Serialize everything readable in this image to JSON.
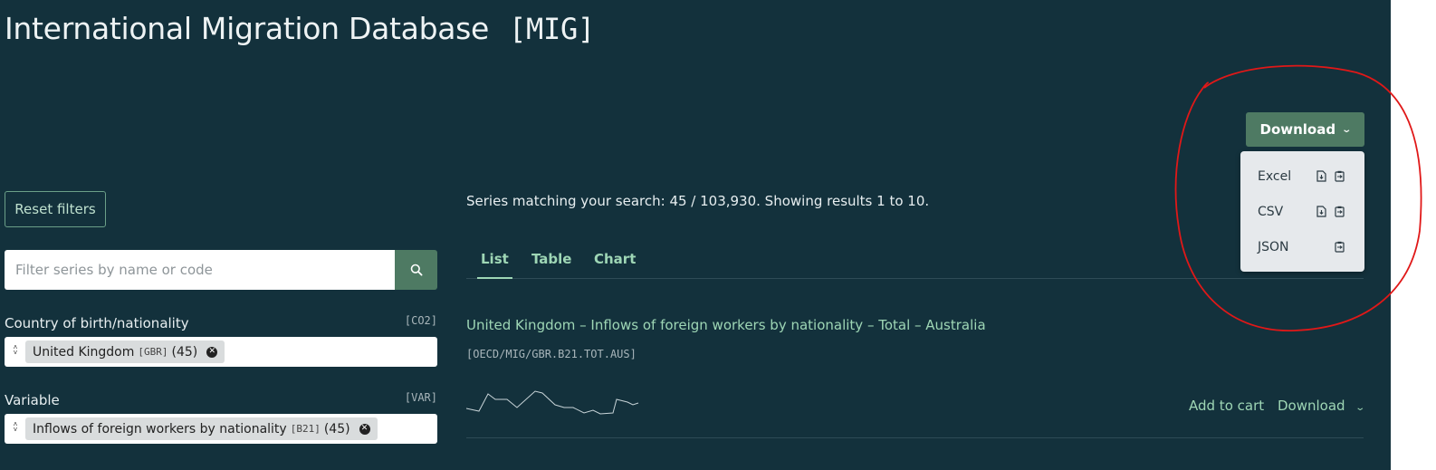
{
  "page": {
    "title": "International Migration Database",
    "code": "[MIG]"
  },
  "download_menu": {
    "button_label": "Download",
    "items": [
      {
        "label": "Excel",
        "icons": [
          "file-download-icon",
          "clipboard-copy-icon"
        ]
      },
      {
        "label": "CSV",
        "icons": [
          "file-download-icon",
          "clipboard-copy-icon"
        ]
      },
      {
        "label": "JSON",
        "icons": [
          "clipboard-copy-icon"
        ]
      }
    ]
  },
  "sidebar": {
    "reset_label": "Reset filters",
    "search": {
      "placeholder": "Filter series by name or code",
      "value": ""
    },
    "filters": [
      {
        "label": "Country of birth/nationality",
        "code": "[CO2]",
        "chip": {
          "text": "United Kingdom",
          "code": "[GBR]",
          "count": "(45)"
        }
      },
      {
        "label": "Variable",
        "code": "[VAR]",
        "chip": {
          "text": "Inflows of foreign workers by nationality",
          "code": "[B21]",
          "count": "(45)"
        }
      }
    ]
  },
  "main": {
    "summary": "Series matching your search: 45 / 103,930. Showing results 1 to 10.",
    "tabs": [
      {
        "label": "List",
        "active": true
      },
      {
        "label": "Table",
        "active": false
      },
      {
        "label": "Chart",
        "active": false
      }
    ],
    "results": [
      {
        "title": "United Kingdom – Inflows of foreign workers by nationality – Total – Australia",
        "code": "[OECD/MIG/GBR.B21.TOT.AUS]",
        "add_to_cart": "Add to cart",
        "download": "Download"
      }
    ]
  },
  "colors": {
    "background": "#13313c",
    "accent": "#4e7a63",
    "link": "#9ed6b5",
    "annotation": "#e01818"
  }
}
